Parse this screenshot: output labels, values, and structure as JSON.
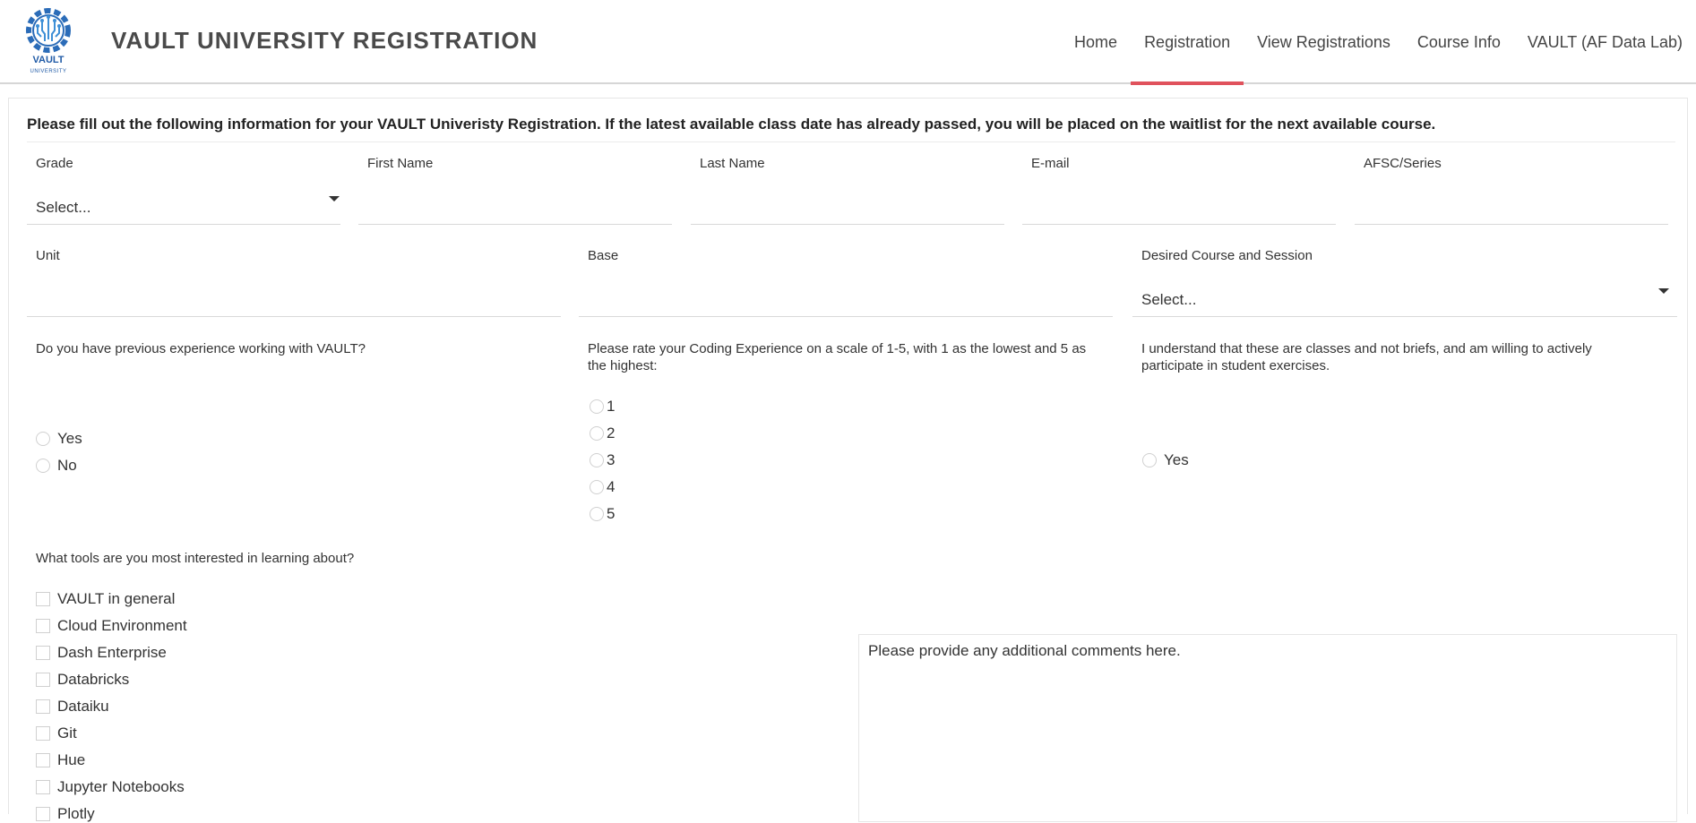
{
  "header": {
    "logo_text": "VAULT",
    "logo_subtext": "UNIVERSITY",
    "title": "VAULT UNIVERSITY REGISTRATION",
    "nav": [
      "Home",
      "Registration",
      "View Registrations",
      "Course Info",
      "VAULT (AF Data Lab)"
    ],
    "active_nav": "Registration",
    "accent_color": "#e0525c"
  },
  "form": {
    "instructions": "Please fill out the following information for your VAULT Univeristy Registration. If the latest available class date has already passed, you will be placed on the waitlist for the next available course.",
    "grade": {
      "label": "Grade",
      "value": "Select..."
    },
    "first_name": {
      "label": "First Name",
      "value": ""
    },
    "last_name": {
      "label": "Last Name",
      "value": ""
    },
    "email": {
      "label": "E-mail",
      "value": ""
    },
    "afsc": {
      "label": "AFSC/Series",
      "value": ""
    },
    "unit": {
      "label": "Unit",
      "value": ""
    },
    "base": {
      "label": "Base",
      "value": ""
    },
    "course": {
      "label": "Desired Course and Session",
      "value": "Select..."
    },
    "experience": {
      "question": "Do you have previous experience working with VAULT?",
      "options": [
        "Yes",
        "No"
      ]
    },
    "coding": {
      "question": "Please rate your Coding Experience on a scale of 1-5, with 1 as the lowest and 5 as the highest:",
      "options": [
        "1",
        "2",
        "3",
        "4",
        "5"
      ]
    },
    "acknowledge": {
      "question": "I understand that these are classes and not briefs, and am willing to actively participate in student exercises.",
      "options": [
        "Yes"
      ]
    },
    "tools": {
      "question": "What tools are you most interested in learning about?",
      "options": [
        "VAULT in general",
        "Cloud Environment",
        "Dash Enterprise",
        "Databricks",
        "Dataiku",
        "Git",
        "Hue",
        "Jupyter Notebooks",
        "Plotly"
      ]
    },
    "comments_placeholder": "Please provide any additional comments here."
  }
}
